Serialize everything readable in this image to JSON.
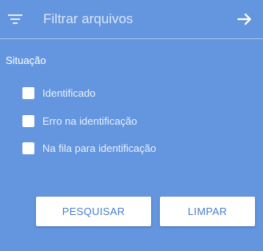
{
  "header": {
    "search_placeholder": "Filtrar arquivos",
    "filter_icon": "filter-list-icon",
    "submit_icon": "arrow-right-icon"
  },
  "status_section": {
    "label": "Situação",
    "options": [
      {
        "label": "Identificado",
        "checked": false
      },
      {
        "label": "Erro na identificação",
        "checked": false
      },
      {
        "label": "Na fila para identificação",
        "checked": false
      }
    ]
  },
  "actions": {
    "search_label": "PESQUISAR",
    "clear_label": "LIMPAR"
  },
  "colors": {
    "panel_background": "#6496df",
    "button_text": "#4a7fd0",
    "button_background": "#ffffff"
  }
}
